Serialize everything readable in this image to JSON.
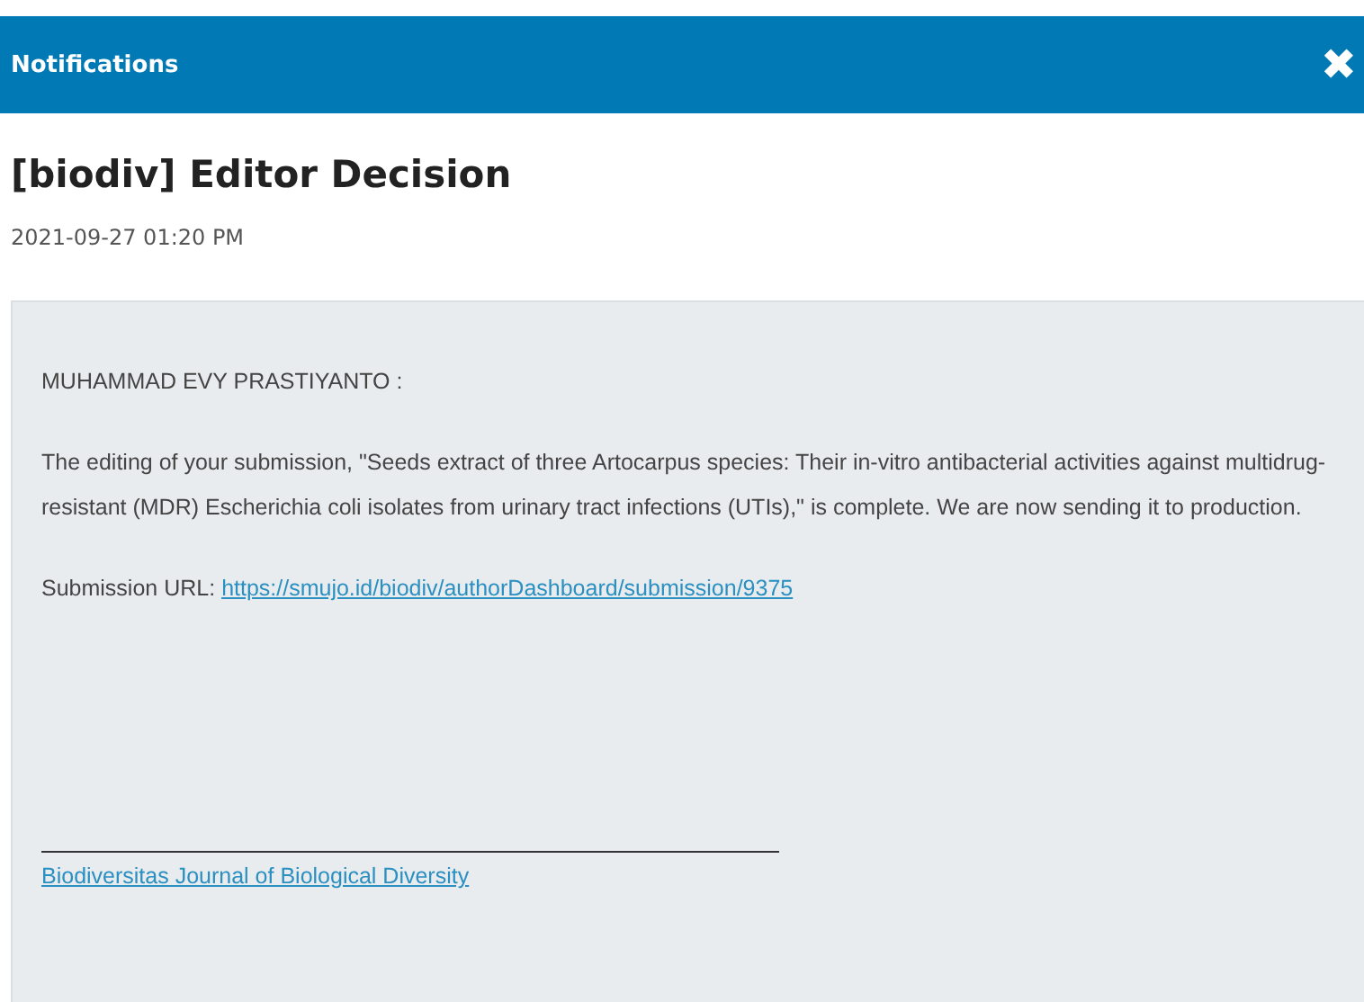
{
  "header": {
    "title": "Notifications",
    "close_glyph": "✖"
  },
  "message": {
    "subject": "[biodiv] Editor Decision",
    "date": "2021-09-27 01:20 PM",
    "greeting": "MUHAMMAD EVY PRASTIYANTO :",
    "body": "The editing of your submission, \"Seeds extract of three Artocarpus species: Their in-vitro antibacterial activities against multidrug-resistant (MDR) Escherichia coli isolates from urinary tract infections (UTIs),\" is complete. We are now sending it to production.",
    "url_label": "Submission URL:",
    "url": "https://smujo.id/biodiv/authorDashboard/submission/9375",
    "signature": "Biodiversitas Journal of Biological Diversity"
  }
}
